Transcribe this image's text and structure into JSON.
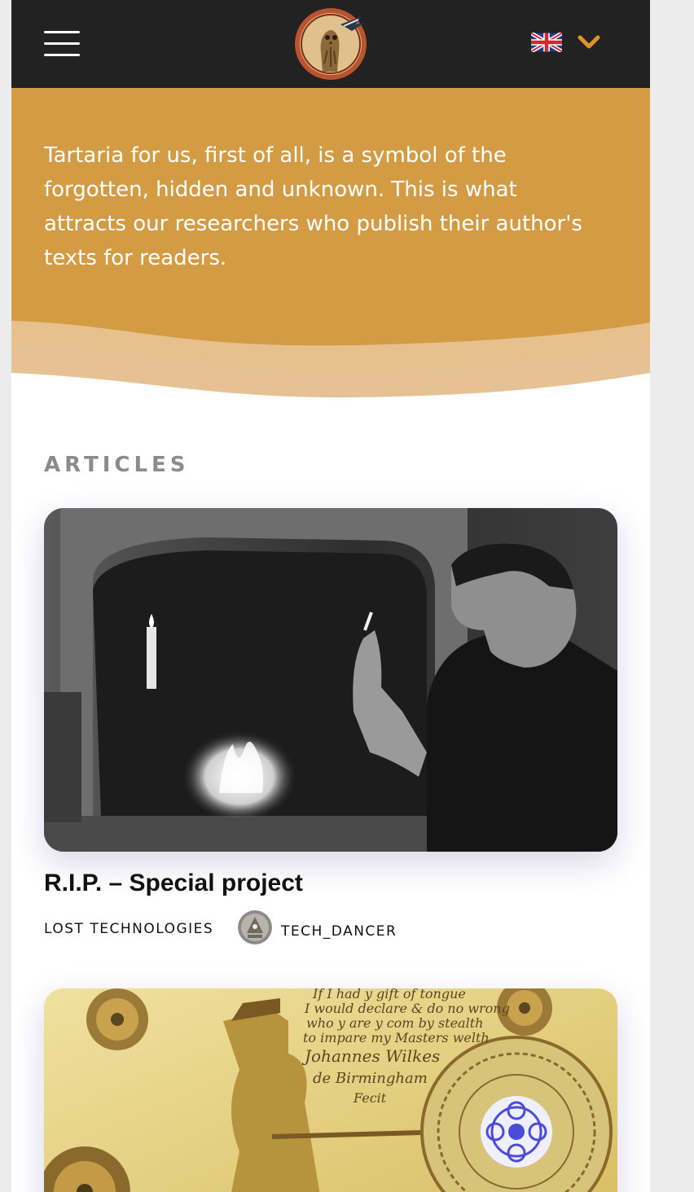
{
  "header": {
    "menu_icon": "hamburger-menu-icon",
    "logo_icon": "owl-emblem-logo",
    "language": {
      "flag_icon": "uk-flag-icon",
      "dropdown_icon": "chevron-down-icon"
    }
  },
  "hero": {
    "text": "Tartaria for us, first of all, is a symbol of the forgotten, hidden and unknown. This is what attracts our researchers who publish their author's texts for readers."
  },
  "articles": {
    "section_title": "ARTICLES",
    "items": [
      {
        "title": "R.I.P. – Special project",
        "category": "LOST TECHNOLOGIES",
        "author": "TECH_DANCER",
        "image": "black-and-white photo of a man smoking beside a fireplace"
      },
      {
        "image": "gold engraved plate with inscription and dial",
        "inscription": [
          "If I had y gift of tongue",
          "I would declare & do no wrong",
          "who y are y com by stealth",
          "to impare my Masters welth",
          "Johannes Wilkes",
          "de Birmingham",
          "Fecit"
        ]
      }
    ]
  },
  "colors": {
    "topbar": "#222222",
    "hero": "#d49b45",
    "wave_light": "#e7c18d",
    "accent_chevron": "#e0932a",
    "section_title": "#8b8b8b"
  }
}
